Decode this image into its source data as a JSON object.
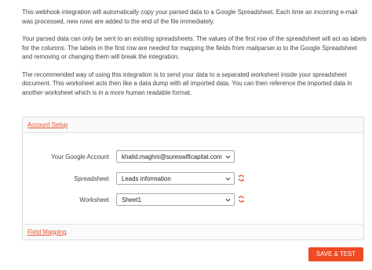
{
  "intro": {
    "p1": "This webhook integration will automatically copy your parsed data to a Google Spreadsheet. Each time an incoming e-mail was processed, new rows are added to the end of the file immediately.",
    "p2": "Your parsed data can only be sent to an existing spreadsheets. The values of the first row of the spreadsheet will act as labels for the columns. The labels in the first row are needed for mapping the fields from mailparser.io to the Google Spreadsheet and removing or changing them will break the integration.",
    "p3": "The recommended way of using this integration is to send your data to a separated worksheet inside your spreadsheet document. This worksheet acts then like a data dump with all imported data. You can then reference the imported data in another worksheet which is in a more human readable format."
  },
  "account_setup": {
    "title": "Account Setup",
    "google_account": {
      "label": "Your Google Account",
      "value": "khalid.maghni@sureswiftcapital.com"
    },
    "spreadsheet": {
      "label": "Spreadsheet",
      "value": "Leads information"
    },
    "worksheet": {
      "label": "Worksheet",
      "value": "Sheet1"
    }
  },
  "field_mapping": {
    "title": "Field Mapping"
  },
  "actions": {
    "save_test": "SAVE & TEST"
  },
  "colors": {
    "accent": "#ee4a24",
    "link": "#e8502a"
  },
  "icons": {
    "caret": "chevron-down-icon",
    "refresh": "refresh-icon"
  }
}
